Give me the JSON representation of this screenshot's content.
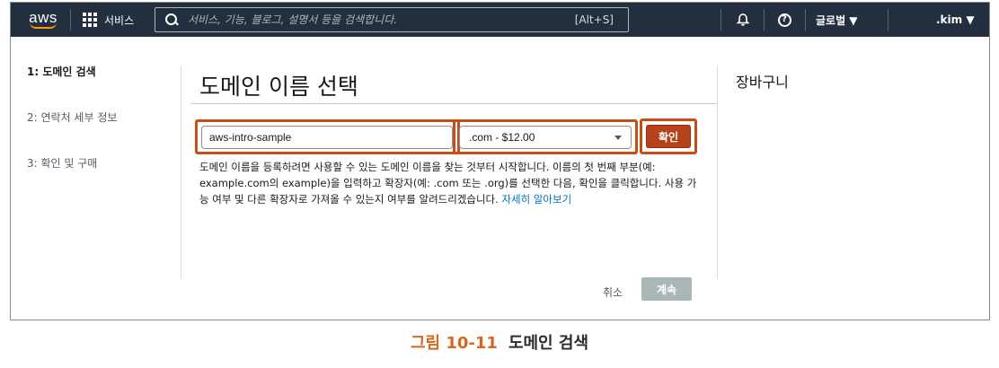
{
  "nav": {
    "logo_text": "aws",
    "services_label": "서비스",
    "search_placeholder": "서비스, 기능, 블로그, 설명서 등을 검색합니다.",
    "search_shortcut": "[Alt+S]",
    "region_label": "글로벌 ▼",
    "user_label": ".kim ▼",
    "icons": [
      "grid-icon",
      "search-icon",
      "bell-icon",
      "help-icon"
    ],
    "background_color": "#232f3e"
  },
  "steps": [
    {
      "label": "1: 도메인 검색",
      "active": true
    },
    {
      "label": "2: 연락처 세부 정보",
      "active": false
    },
    {
      "label": "3: 확인 및 구매",
      "active": false
    }
  ],
  "main": {
    "title": "도메인 이름 선택",
    "domain_value": "aws-intro-sample",
    "tld_selected": ".com - $12.00",
    "check_label": "확인",
    "description": "도메인 이름을 등록하려면 사용할 수 있는 도메인 이름을 찾는 것부터 시작합니다. 이름의 첫 번째 부분(예: example.com의 example)을 입력하고 확장자(예: .com 또는 .org)를 선택한 다음, 확인을 클릭합니다. 사용 가능 여부 및 다른 확장자로 가져올 수 있는지 여부를 알려드리겠습니다.",
    "learn_more": "자세히 알아보기",
    "cancel_label": "취소",
    "continue_label": "계속"
  },
  "cart": {
    "title": "장바구니"
  },
  "caption": {
    "figure_number": "그림 10-11",
    "figure_title": "도메인 검색"
  },
  "colors": {
    "highlight": "#c84d17",
    "accent_orange": "#ff9900",
    "caption_number": "#d9651f",
    "link": "#0073bb"
  }
}
